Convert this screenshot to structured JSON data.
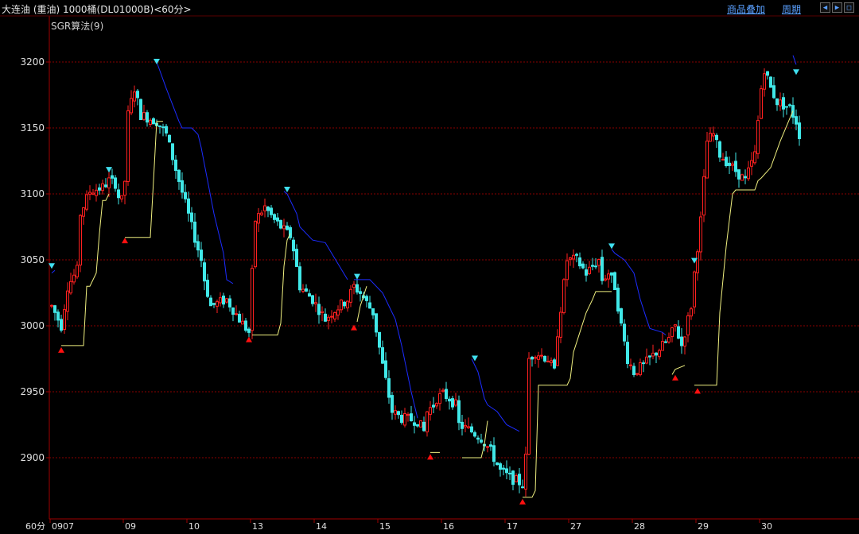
{
  "header": {
    "title": "大连油 (重油) 1000桶(DL01000B)<60分>",
    "links": [
      "商品叠加",
      "周期"
    ],
    "nav_buttons": [
      "left-arrow-icon",
      "right-arrow-icon",
      "restore-icon"
    ]
  },
  "indicator_label": "SGR算法(9)",
  "colors": {
    "background": "#000000",
    "up": "#ff2020",
    "down": "#40e8e8",
    "resistance_line": "#1c2cff",
    "support_line": "#f0f080",
    "grid": "#8a0000",
    "axis": "#a00000",
    "sell_marker": "#40e0f0",
    "buy_marker": "#ff1010"
  },
  "chart_data": {
    "type": "candlestick",
    "title": "大连油 (重油) 1000桶(DL01000B)<60分>",
    "ylim": [
      2865,
      3225
    ],
    "y_ticks": [
      2900,
      2950,
      3000,
      3050,
      3100,
      3150,
      3200
    ],
    "grid": true,
    "x_axis_label": "60分",
    "x_ticks": [
      {
        "bar": 0,
        "label": "0907"
      },
      {
        "bar": 23,
        "label": "09"
      },
      {
        "bar": 43,
        "label": "10"
      },
      {
        "bar": 63,
        "label": "13"
      },
      {
        "bar": 83,
        "label": "14"
      },
      {
        "bar": 103,
        "label": "15"
      },
      {
        "bar": 123,
        "label": "16"
      },
      {
        "bar": 143,
        "label": "17"
      },
      {
        "bar": 163,
        "label": "27"
      },
      {
        "bar": 183,
        "label": "28"
      },
      {
        "bar": 203,
        "label": "29"
      },
      {
        "bar": 223,
        "label": "30"
      }
    ],
    "bar_count": 236,
    "anchors": [
      [
        0,
        3015
      ],
      [
        3,
        3000
      ],
      [
        5,
        3030
      ],
      [
        8,
        3042
      ],
      [
        9,
        3085
      ],
      [
        12,
        3102
      ],
      [
        16,
        3105
      ],
      [
        18,
        3110
      ],
      [
        20,
        3108
      ],
      [
        21,
        3098
      ],
      [
        22,
        3095
      ],
      [
        23,
        3110
      ],
      [
        24,
        3160
      ],
      [
        26,
        3180
      ],
      [
        28,
        3160
      ],
      [
        33,
        3155
      ],
      [
        36,
        3145
      ],
      [
        40,
        3110
      ],
      [
        44,
        3075
      ],
      [
        47,
        3050
      ],
      [
        48,
        3035
      ],
      [
        50,
        3015
      ],
      [
        55,
        3020
      ],
      [
        59,
        3005
      ],
      [
        62,
        2995
      ],
      [
        63,
        3040
      ],
      [
        64,
        3080
      ],
      [
        67,
        3090
      ],
      [
        70,
        3080
      ],
      [
        72,
        3075
      ],
      [
        74,
        3070
      ],
      [
        75,
        3068
      ],
      [
        76,
        3058
      ],
      [
        78,
        3030
      ],
      [
        82,
        3020
      ],
      [
        86,
        3005
      ],
      [
        88,
        3010
      ],
      [
        93,
        3020
      ],
      [
        95,
        3030
      ],
      [
        97,
        3025
      ],
      [
        101,
        3010
      ],
      [
        104,
        2970
      ],
      [
        107,
        2935
      ],
      [
        110,
        2930
      ],
      [
        115,
        2928
      ],
      [
        117,
        2920
      ],
      [
        118,
        2935
      ],
      [
        120,
        2940
      ],
      [
        121,
        2945
      ],
      [
        123,
        2948
      ],
      [
        125,
        2945
      ],
      [
        127,
        2940
      ],
      [
        128,
        2925
      ],
      [
        132,
        2920
      ],
      [
        135,
        2915
      ],
      [
        138,
        2905
      ],
      [
        141,
        2890
      ],
      [
        144,
        2885
      ],
      [
        148,
        2880
      ],
      [
        149,
        2900
      ],
      [
        150,
        2975
      ],
      [
        152,
        2980
      ],
      [
        156,
        2975
      ],
      [
        158,
        2965
      ],
      [
        159,
        2995
      ],
      [
        162,
        3050
      ],
      [
        165,
        3050
      ],
      [
        168,
        3040
      ],
      [
        170,
        3045
      ],
      [
        172,
        3050
      ],
      [
        173,
        3035
      ],
      [
        175,
        3040
      ],
      [
        177,
        3030
      ],
      [
        179,
        3000
      ],
      [
        181,
        2975
      ],
      [
        183,
        2965
      ],
      [
        186,
        2970
      ],
      [
        190,
        2980
      ],
      [
        192,
        2985
      ],
      [
        194,
        2990
      ],
      [
        196,
        3000
      ],
      [
        198,
        2985
      ],
      [
        201,
        3015
      ],
      [
        202,
        3040
      ],
      [
        204,
        3080
      ],
      [
        206,
        3140
      ],
      [
        208,
        3145
      ],
      [
        210,
        3130
      ],
      [
        214,
        3120
      ],
      [
        218,
        3110
      ],
      [
        221,
        3130
      ],
      [
        223,
        3180
      ],
      [
        224,
        3195
      ],
      [
        226,
        3180
      ],
      [
        228,
        3170
      ],
      [
        232,
        3165
      ],
      [
        234,
        3155
      ],
      [
        235,
        3145
      ]
    ],
    "series": [
      {
        "kind": "resistance",
        "segments": [
          {
            "x": [
              0,
              1
            ],
            "y": [
              3040,
              3042
            ]
          },
          {
            "x": [
              33,
              36,
              40,
              41,
              44,
              46,
              47,
              49,
              51,
              54,
              55,
              57
            ],
            "y": [
              3200,
              3180,
              3155,
              3150,
              3150,
              3145,
              3135,
              3110,
              3085,
              3055,
              3035,
              3032
            ]
          },
          {
            "x": [
              73,
              74,
              77,
              78,
              80,
              82,
              86,
              88,
              93
            ],
            "y": [
              3102,
              3100,
              3085,
              3075,
              3070,
              3065,
              3063,
              3055,
              3035
            ]
          },
          {
            "x": [
              95,
              100,
              104,
              106,
              108,
              110,
              113,
              115
            ],
            "y": [
              3035,
              3035,
              3025,
              3015,
              3005,
              2985,
              2950,
              2930
            ]
          },
          {
            "x": [
              132,
              134,
              136,
              137,
              140,
              143,
              147
            ],
            "y": [
              2975,
              2965,
              2945,
              2940,
              2935,
              2925,
              2920
            ]
          },
          {
            "x": [
              176,
              177,
              180,
              183,
              185,
              187,
              188,
              192,
              193
            ],
            "y": [
              3058,
              3055,
              3050,
              3040,
              3020,
              3005,
              2998,
              2995,
              2993
            ]
          },
          {
            "x": [
              233,
              234
            ],
            "y": [
              3205,
              3198
            ]
          }
        ]
      },
      {
        "kind": "support",
        "segments": [
          {
            "x": [
              3,
              10,
              11,
              12,
              14,
              15,
              16,
              17,
              18
            ],
            "y": [
              2985,
              2985,
              3030,
              3030,
              3040,
              3070,
              3095,
              3095,
              3100
            ]
          },
          {
            "x": [
              23,
              31,
              32,
              33,
              35
            ],
            "y": [
              3067,
              3067,
              3110,
              3155,
              3155
            ]
          },
          {
            "x": [
              63,
              71,
              72,
              73,
              74,
              75
            ],
            "y": [
              2993,
              2993,
              3002,
              3045,
              3065,
              3070
            ]
          },
          {
            "x": [
              96,
              97,
              99
            ],
            "y": [
              3003,
              3015,
              3030
            ]
          },
          {
            "x": [
              119,
              122
            ],
            "y": [
              2904,
              2904
            ]
          },
          {
            "x": [
              129,
              135,
              136,
              137
            ],
            "y": [
              2900,
              2900,
              2910,
              2928
            ]
          },
          {
            "x": [
              148,
              151,
              152,
              153,
              156,
              162,
              163,
              164,
              166,
              168,
              170,
              171,
              176
            ],
            "y": [
              2870,
              2870,
              2875,
              2955,
              2955,
              2955,
              2960,
              2980,
              2995,
              3010,
              3020,
              3026,
              3026
            ]
          },
          {
            "x": [
              195,
              196,
              199
            ],
            "y": [
              2963,
              2967,
              2970
            ]
          },
          {
            "x": [
              202,
              209,
              210,
              212,
              214,
              215,
              221,
              222,
              223,
              226,
              229,
              233
            ],
            "y": [
              2955,
              2955,
              3010,
              3060,
              3100,
              3103,
              3103,
              3110,
              3112,
              3120,
              3140,
              3163
            ]
          }
        ]
      }
    ],
    "sell_signals": [
      {
        "bar": 0,
        "price": 3045
      },
      {
        "bar": 18,
        "price": 3118
      },
      {
        "bar": 33,
        "price": 3200
      },
      {
        "bar": 74,
        "price": 3103
      },
      {
        "bar": 96,
        "price": 3037
      },
      {
        "bar": 133,
        "price": 2975
      },
      {
        "bar": 176,
        "price": 3060
      },
      {
        "bar": 202,
        "price": 3049
      },
      {
        "bar": 234,
        "price": 3192
      }
    ],
    "buy_signals": [
      {
        "bar": 3,
        "price": 2982
      },
      {
        "bar": 23,
        "price": 3065
      },
      {
        "bar": 62,
        "price": 2990
      },
      {
        "bar": 95,
        "price": 2999
      },
      {
        "bar": 119,
        "price": 2901
      },
      {
        "bar": 148,
        "price": 2867
      },
      {
        "bar": 196,
        "price": 2961
      },
      {
        "bar": 203,
        "price": 2951
      }
    ]
  }
}
